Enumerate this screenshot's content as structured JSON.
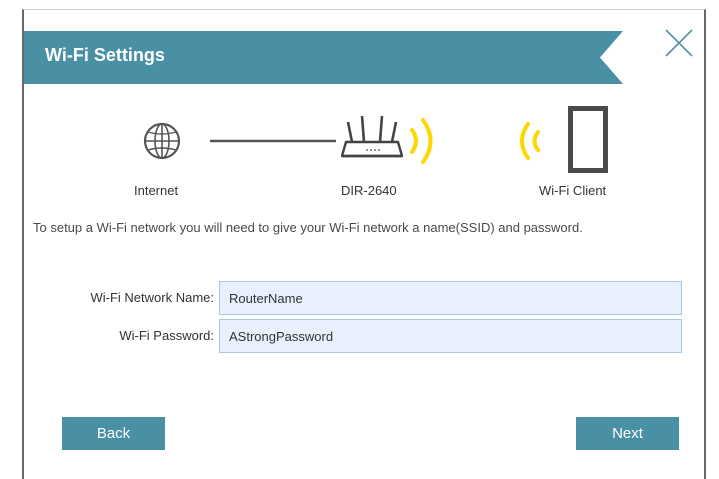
{
  "dialog": {
    "title": "Wi-Fi Settings",
    "accent_color": "#4a90a4",
    "close_icon": "close-icon"
  },
  "diagram": {
    "internet_label": "Internet",
    "router_label": "DIR-2640",
    "client_label": "Wi-Fi Client",
    "signal_color": "#ffd700",
    "icons": [
      "globe-icon",
      "router-icon",
      "wifi-signal-icon",
      "tablet-icon"
    ]
  },
  "intro": {
    "text": "To setup a Wi-Fi network you will need to give your Wi-Fi network a name(SSID) and password."
  },
  "form": {
    "network_name_label": "Wi-Fi Network Name:",
    "network_name_value": "RouterName",
    "password_label": "Wi-Fi Password:",
    "password_value": "AStrongPassword"
  },
  "buttons": {
    "back_label": "Back",
    "next_label": "Next"
  }
}
